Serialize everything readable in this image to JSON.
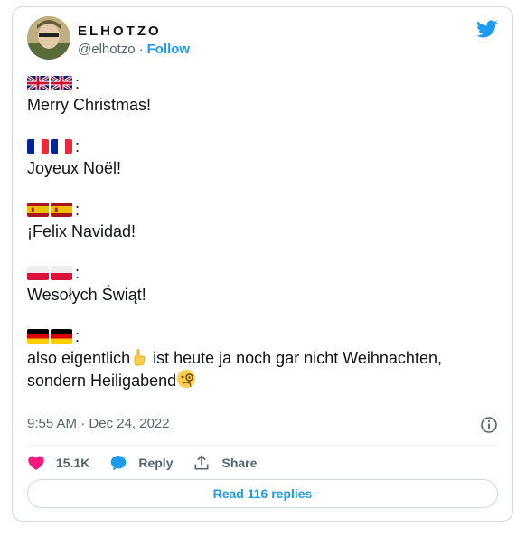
{
  "author": {
    "display_name": "ELHOTZO",
    "handle": "@elhotzo",
    "separator": "·",
    "follow_label": "Follow"
  },
  "tweet": {
    "stanzas": [
      {
        "flag": "uk-flag",
        "colon": ":",
        "text": "Merry Christmas!"
      },
      {
        "flag": "france-flag",
        "colon": ":",
        "text": "Joyeux Noël!"
      },
      {
        "flag": "spain-flag",
        "colon": ":",
        "text": "¡Felix Navidad!"
      },
      {
        "flag": "poland-flag",
        "colon": ":",
        "text": "Wesołych Świąt!"
      },
      {
        "flag": "germany-flag",
        "colon": ":",
        "text_line1_a": "also eigentlich",
        "text_line1_b": "ist heute ja noch gar nicht Weihnachten,",
        "text_line2": "sondern Heiligabend"
      }
    ]
  },
  "meta": {
    "time": "9:55 AM",
    "separator": "·",
    "date": "Dec 24, 2022"
  },
  "actions": {
    "likes": "15.1K",
    "reply_label": "Reply",
    "share_label": "Share"
  },
  "replies_button": "Read 116 replies",
  "colors": {
    "accent": "#1d9bf0",
    "like": "#f91880",
    "text": "#0f1419",
    "secondary": "#536471"
  },
  "icons": [
    "twitter-bird-icon",
    "info-icon",
    "heart-icon",
    "reply-bubble-icon",
    "share-icon",
    "pointing-up-emoji",
    "monocle-face-emoji"
  ]
}
